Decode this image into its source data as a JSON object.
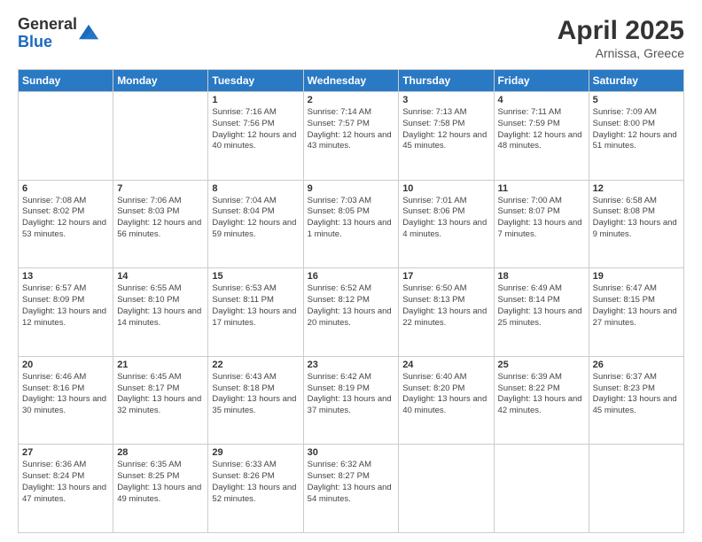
{
  "logo": {
    "general": "General",
    "blue": "Blue"
  },
  "header": {
    "month": "April 2025",
    "location": "Arnissa, Greece"
  },
  "days_of_week": [
    "Sunday",
    "Monday",
    "Tuesday",
    "Wednesday",
    "Thursday",
    "Friday",
    "Saturday"
  ],
  "weeks": [
    [
      {
        "day": "",
        "info": ""
      },
      {
        "day": "",
        "info": ""
      },
      {
        "day": "1",
        "info": "Sunrise: 7:16 AM\nSunset: 7:56 PM\nDaylight: 12 hours and 40 minutes."
      },
      {
        "day": "2",
        "info": "Sunrise: 7:14 AM\nSunset: 7:57 PM\nDaylight: 12 hours and 43 minutes."
      },
      {
        "day": "3",
        "info": "Sunrise: 7:13 AM\nSunset: 7:58 PM\nDaylight: 12 hours and 45 minutes."
      },
      {
        "day": "4",
        "info": "Sunrise: 7:11 AM\nSunset: 7:59 PM\nDaylight: 12 hours and 48 minutes."
      },
      {
        "day": "5",
        "info": "Sunrise: 7:09 AM\nSunset: 8:00 PM\nDaylight: 12 hours and 51 minutes."
      }
    ],
    [
      {
        "day": "6",
        "info": "Sunrise: 7:08 AM\nSunset: 8:02 PM\nDaylight: 12 hours and 53 minutes."
      },
      {
        "day": "7",
        "info": "Sunrise: 7:06 AM\nSunset: 8:03 PM\nDaylight: 12 hours and 56 minutes."
      },
      {
        "day": "8",
        "info": "Sunrise: 7:04 AM\nSunset: 8:04 PM\nDaylight: 12 hours and 59 minutes."
      },
      {
        "day": "9",
        "info": "Sunrise: 7:03 AM\nSunset: 8:05 PM\nDaylight: 13 hours and 1 minute."
      },
      {
        "day": "10",
        "info": "Sunrise: 7:01 AM\nSunset: 8:06 PM\nDaylight: 13 hours and 4 minutes."
      },
      {
        "day": "11",
        "info": "Sunrise: 7:00 AM\nSunset: 8:07 PM\nDaylight: 13 hours and 7 minutes."
      },
      {
        "day": "12",
        "info": "Sunrise: 6:58 AM\nSunset: 8:08 PM\nDaylight: 13 hours and 9 minutes."
      }
    ],
    [
      {
        "day": "13",
        "info": "Sunrise: 6:57 AM\nSunset: 8:09 PM\nDaylight: 13 hours and 12 minutes."
      },
      {
        "day": "14",
        "info": "Sunrise: 6:55 AM\nSunset: 8:10 PM\nDaylight: 13 hours and 14 minutes."
      },
      {
        "day": "15",
        "info": "Sunrise: 6:53 AM\nSunset: 8:11 PM\nDaylight: 13 hours and 17 minutes."
      },
      {
        "day": "16",
        "info": "Sunrise: 6:52 AM\nSunset: 8:12 PM\nDaylight: 13 hours and 20 minutes."
      },
      {
        "day": "17",
        "info": "Sunrise: 6:50 AM\nSunset: 8:13 PM\nDaylight: 13 hours and 22 minutes."
      },
      {
        "day": "18",
        "info": "Sunrise: 6:49 AM\nSunset: 8:14 PM\nDaylight: 13 hours and 25 minutes."
      },
      {
        "day": "19",
        "info": "Sunrise: 6:47 AM\nSunset: 8:15 PM\nDaylight: 13 hours and 27 minutes."
      }
    ],
    [
      {
        "day": "20",
        "info": "Sunrise: 6:46 AM\nSunset: 8:16 PM\nDaylight: 13 hours and 30 minutes."
      },
      {
        "day": "21",
        "info": "Sunrise: 6:45 AM\nSunset: 8:17 PM\nDaylight: 13 hours and 32 minutes."
      },
      {
        "day": "22",
        "info": "Sunrise: 6:43 AM\nSunset: 8:18 PM\nDaylight: 13 hours and 35 minutes."
      },
      {
        "day": "23",
        "info": "Sunrise: 6:42 AM\nSunset: 8:19 PM\nDaylight: 13 hours and 37 minutes."
      },
      {
        "day": "24",
        "info": "Sunrise: 6:40 AM\nSunset: 8:20 PM\nDaylight: 13 hours and 40 minutes."
      },
      {
        "day": "25",
        "info": "Sunrise: 6:39 AM\nSunset: 8:22 PM\nDaylight: 13 hours and 42 minutes."
      },
      {
        "day": "26",
        "info": "Sunrise: 6:37 AM\nSunset: 8:23 PM\nDaylight: 13 hours and 45 minutes."
      }
    ],
    [
      {
        "day": "27",
        "info": "Sunrise: 6:36 AM\nSunset: 8:24 PM\nDaylight: 13 hours and 47 minutes."
      },
      {
        "day": "28",
        "info": "Sunrise: 6:35 AM\nSunset: 8:25 PM\nDaylight: 13 hours and 49 minutes."
      },
      {
        "day": "29",
        "info": "Sunrise: 6:33 AM\nSunset: 8:26 PM\nDaylight: 13 hours and 52 minutes."
      },
      {
        "day": "30",
        "info": "Sunrise: 6:32 AM\nSunset: 8:27 PM\nDaylight: 13 hours and 54 minutes."
      },
      {
        "day": "",
        "info": ""
      },
      {
        "day": "",
        "info": ""
      },
      {
        "day": "",
        "info": ""
      }
    ]
  ]
}
